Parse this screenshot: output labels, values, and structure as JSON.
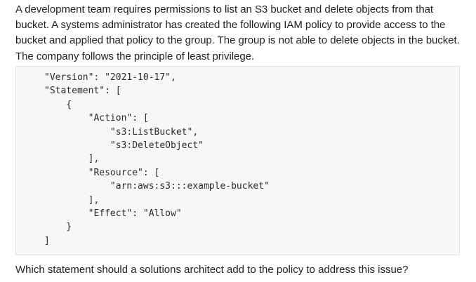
{
  "intro_text": "A development team requires permissions to list an S3 bucket and delete objects from that bucket. A systems administrator has created the following IAM policy to provide access to the bucket and applied that policy to the group. The group is not able to delete objects in the bucket. The company follows the principle of least privilege.",
  "code_lines": [
    "\"Version\": \"2021-10-17\",",
    "\"Statement\": [",
    "    {",
    "        \"Action\": [",
    "            \"s3:ListBucket\",",
    "            \"s3:DeleteObject\"",
    "        ],",
    "        \"Resource\": [",
    "            \"arn:aws:s3:::example-bucket\"",
    "        ],",
    "        \"Effect\": \"Allow\"",
    "    }",
    "]"
  ],
  "question_text": "Which statement should a solutions architect add to the policy to address this issue?"
}
